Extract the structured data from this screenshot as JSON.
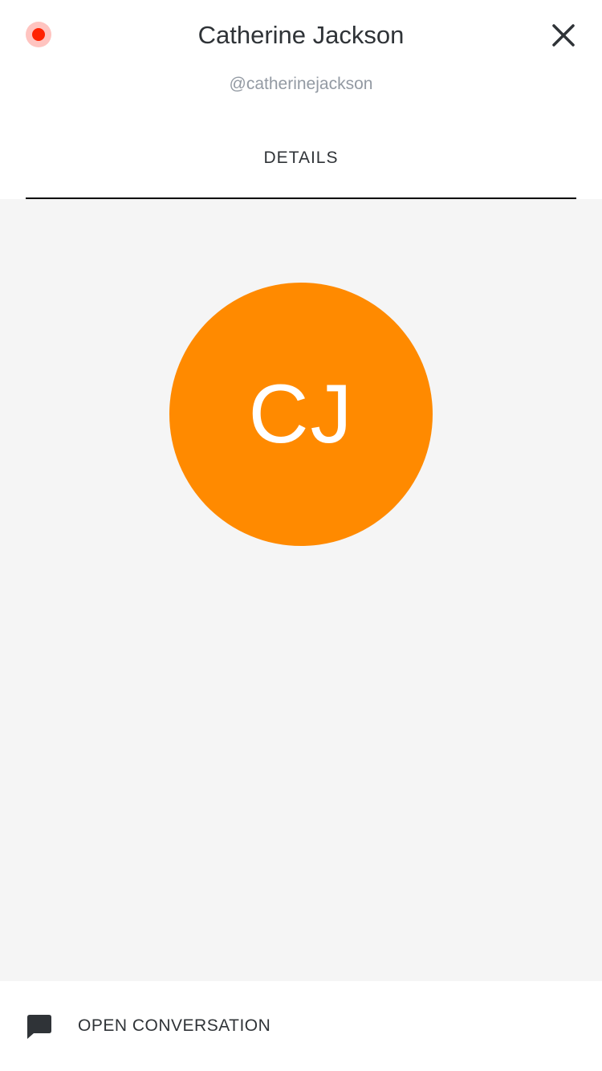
{
  "header": {
    "title": "Catherine Jackson",
    "handle": "@catherinejackson",
    "status_color": "#ff2200",
    "close_icon": "close-icon"
  },
  "tabs": [
    {
      "label": "DETAILS",
      "active": true
    }
  ],
  "profile": {
    "initials": "CJ",
    "avatar_color": "#ff8a00"
  },
  "footer": {
    "action_label": "OPEN CONVERSATION",
    "action_icon": "chat-bubble-icon"
  }
}
